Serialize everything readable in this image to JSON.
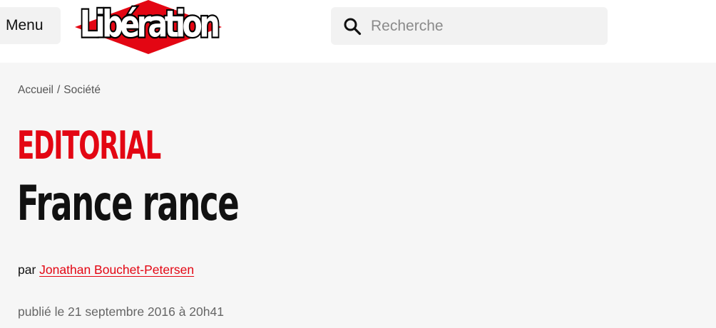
{
  "header": {
    "menu_label": "Menu",
    "logo_text": "Libération",
    "logo_colors": {
      "diamond": "#e30613",
      "text_fill": "#ffffff",
      "text_stroke": "#000000"
    },
    "search": {
      "placeholder": "Recherche",
      "value": "",
      "icon": "search-icon"
    }
  },
  "breadcrumb": {
    "items": [
      "Accueil",
      "Société"
    ],
    "separator": "/"
  },
  "article": {
    "kicker": "EDITORIAL",
    "title": "France rance",
    "byline_prefix": "par",
    "author": "Jonathan Bouchet-Petersen",
    "published": "publié le 21 septembre 2016 à 20h41"
  },
  "colors": {
    "accent": "#e30613",
    "header_bg": "#ffffff",
    "content_bg": "#f6f6f6",
    "control_bg": "#f2f2f2",
    "muted_text": "#666666"
  }
}
